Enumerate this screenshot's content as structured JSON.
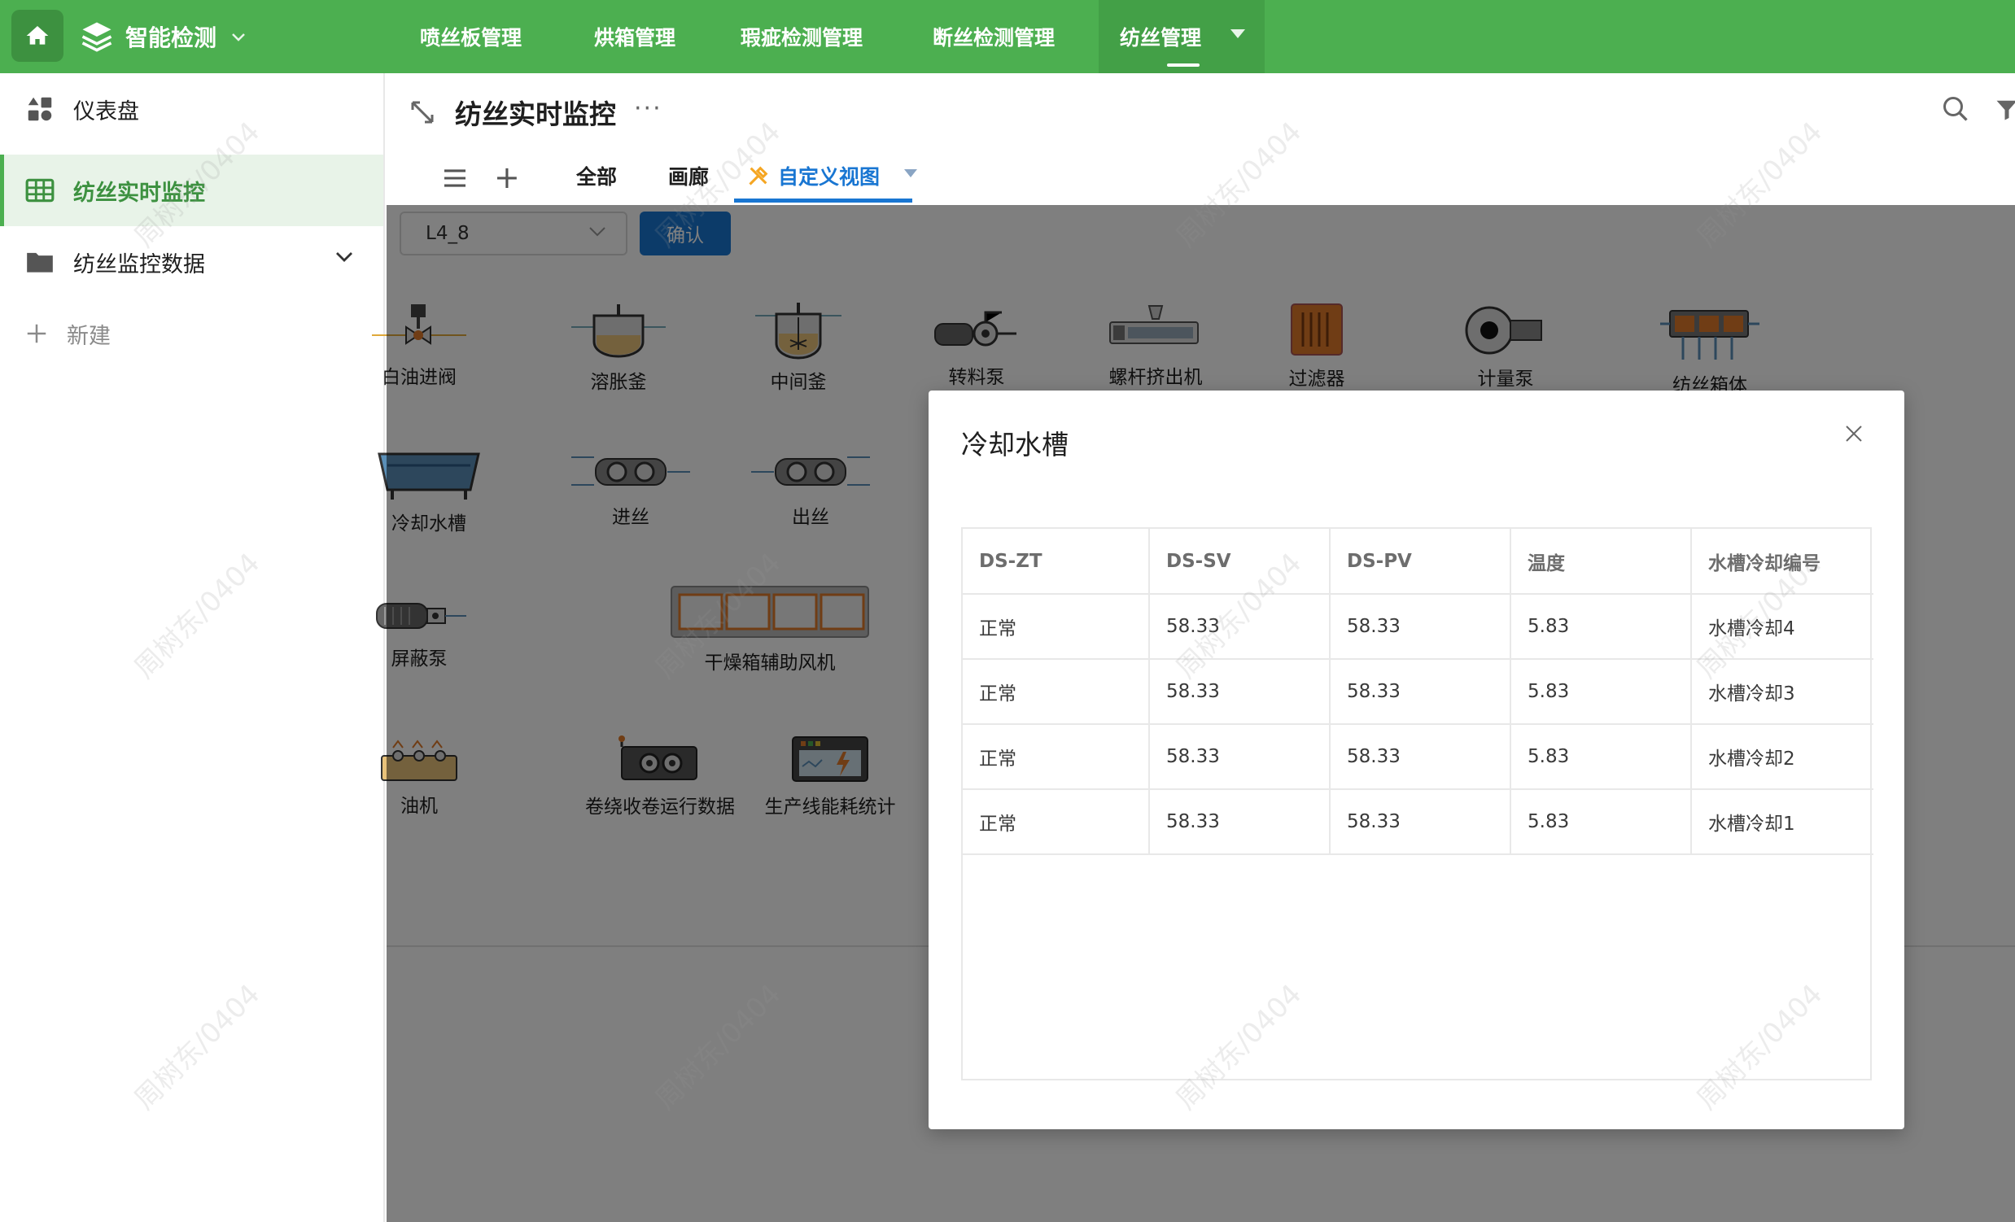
{
  "app": {
    "title": "智能检测"
  },
  "topnav": {
    "items": [
      "喷丝板管理",
      "烘箱管理",
      "瑕疵检测管理",
      "断丝检测管理",
      "纺丝管理"
    ],
    "active": "纺丝管理"
  },
  "sidebar": {
    "items": [
      {
        "label": "仪表盘",
        "icon": "dashboard-icon"
      },
      {
        "label": "纺丝实时监控",
        "icon": "table-icon"
      },
      {
        "label": "纺丝监控数据",
        "icon": "folder-icon"
      }
    ],
    "new_label": "新建"
  },
  "page": {
    "title": "纺丝实时监控",
    "more": "···"
  },
  "tabs": {
    "all": "全部",
    "gallery": "画廊",
    "custom": "自定义视图"
  },
  "toolbar": {
    "select_value": "L4_8",
    "confirm_label": "确认"
  },
  "equipment": [
    {
      "label": "白油进阀",
      "icon": "valve-icon"
    },
    {
      "label": "溶胀釜",
      "icon": "tank-icon"
    },
    {
      "label": "中间釜",
      "icon": "mixer-tank-icon"
    },
    {
      "label": "转料泵",
      "icon": "pump-icon"
    },
    {
      "label": "螺杆挤出机",
      "icon": "extruder-icon"
    },
    {
      "label": "过滤器",
      "icon": "filter-icon"
    },
    {
      "label": "计量泵",
      "icon": "metering-pump-icon"
    },
    {
      "label": "纺丝箱体",
      "icon": "spinning-box-icon"
    },
    {
      "label": "冷却水槽",
      "icon": "cooling-tank-icon"
    },
    {
      "label": "进丝",
      "icon": "feed-roller-icon"
    },
    {
      "label": "出丝",
      "icon": "output-roller-icon"
    },
    {
      "label": "屏蔽泵",
      "icon": "shielded-pump-icon"
    },
    {
      "label": "干燥箱辅助风机",
      "icon": "drying-box-icon"
    },
    {
      "label": "油机",
      "icon": "oil-machine-icon"
    },
    {
      "label": "卷绕收卷运行数据",
      "icon": "winder-icon"
    },
    {
      "label": "生产线能耗统计",
      "icon": "energy-meter-icon"
    }
  ],
  "modal": {
    "title": "冷却水槽",
    "columns": [
      "DS-ZT",
      "DS-SV",
      "DS-PV",
      "温度",
      "水槽冷却编号"
    ],
    "rows": [
      [
        "正常",
        "58.33",
        "58.33",
        "5.83",
        "水槽冷却4"
      ],
      [
        "正常",
        "58.33",
        "58.33",
        "5.83",
        "水槽冷却3"
      ],
      [
        "正常",
        "58.33",
        "58.33",
        "5.83",
        "水槽冷却2"
      ],
      [
        "正常",
        "58.33",
        "58.33",
        "5.83",
        "水槽冷却1"
      ]
    ]
  },
  "watermark": "周树东/0404",
  "colors": {
    "brand_green": "#4caf50",
    "accent_blue": "#1976d2"
  }
}
